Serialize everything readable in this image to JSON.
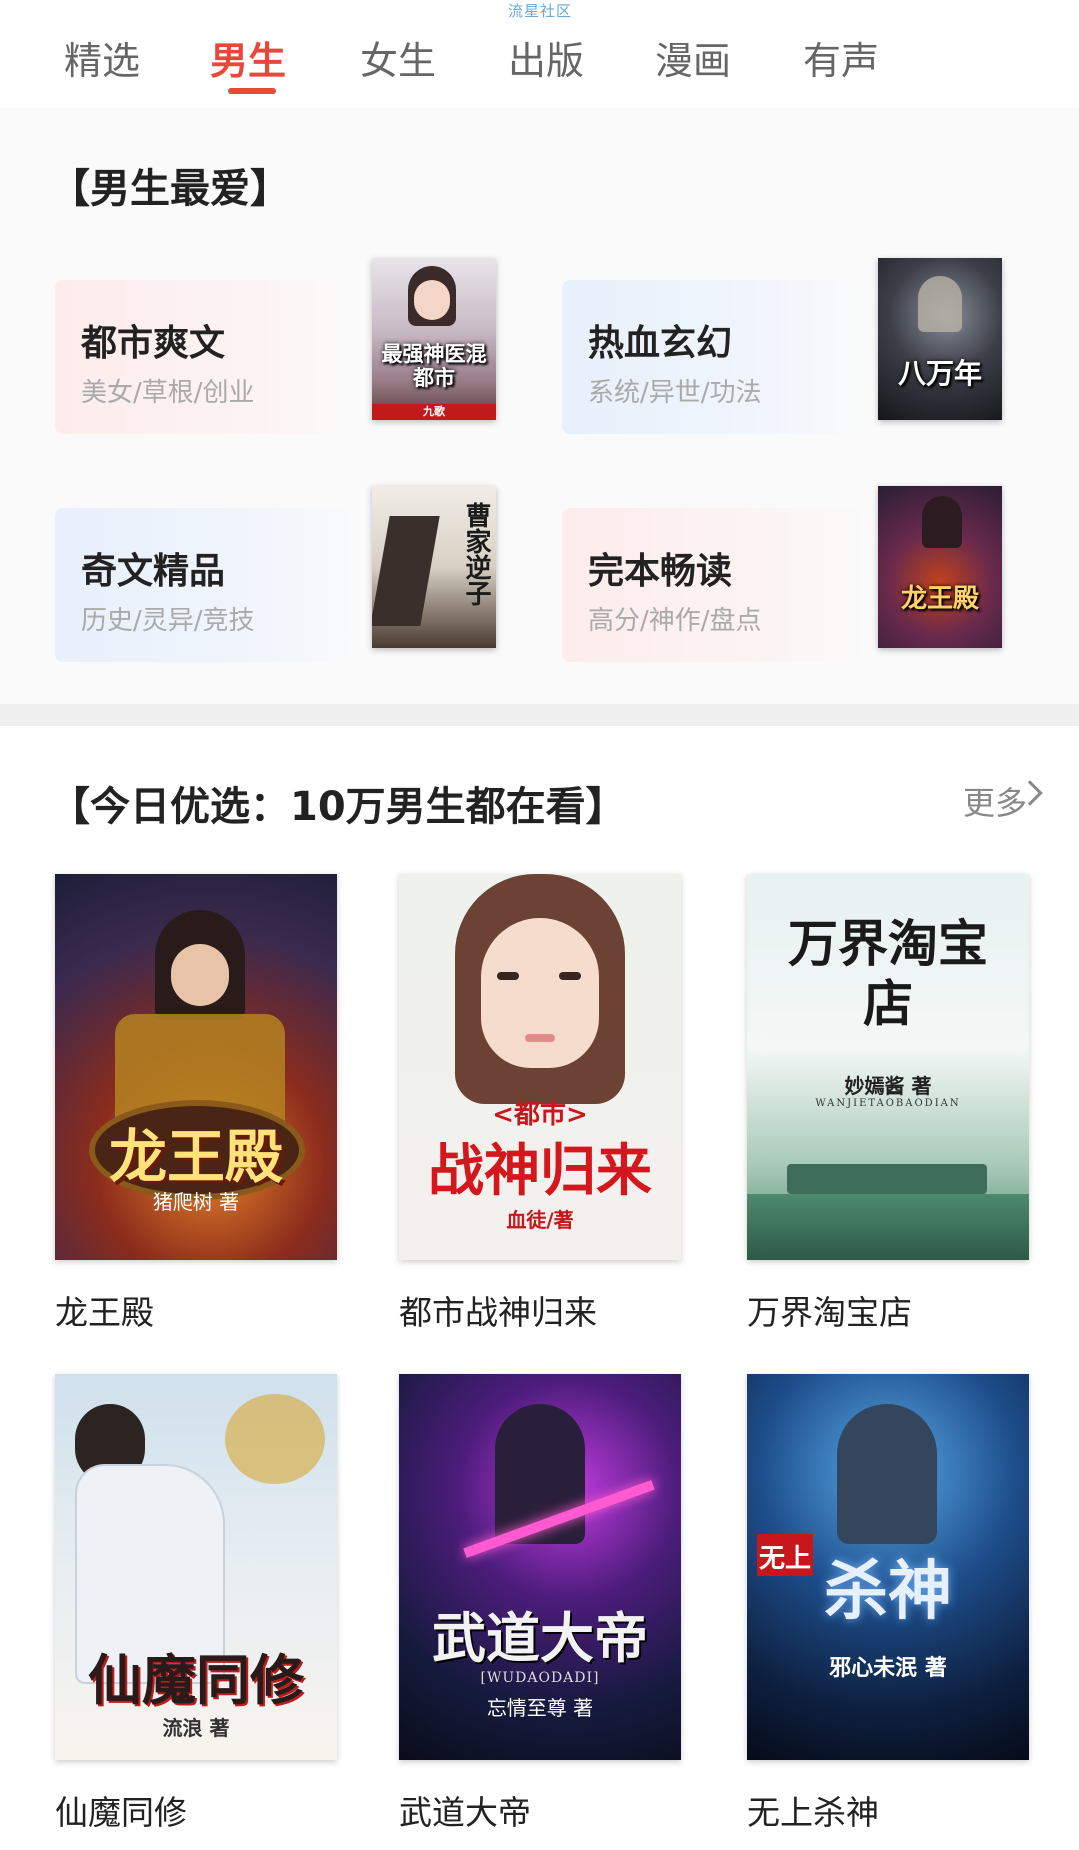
{
  "watermark": "流星社区",
  "tabs": [
    "精选",
    "男生",
    "女生",
    "出版",
    "漫画",
    "有声"
  ],
  "active_tab": "男生",
  "favorites": {
    "title": "【男生最爱】",
    "categories": [
      {
        "name": "都市爽文",
        "sub": "美女/草根/创业",
        "cover_title": "最强神医混都市",
        "cover_author": "九歌"
      },
      {
        "name": "热血玄幻",
        "sub": "系统/异世/功法",
        "cover_title": "八万年"
      },
      {
        "name": "奇文精品",
        "sub": "历史/灵异/竞技",
        "cover_title": "曹家逆子"
      },
      {
        "name": "完本畅读",
        "sub": "高分/神作/盘点",
        "cover_title": "龙王殿"
      }
    ]
  },
  "today": {
    "title": "【今日优选：10万男生都在看】",
    "more": "更多",
    "books": [
      {
        "title": "龙王殿",
        "cover_title": "龙王殿",
        "cover_author": "猪爬树 著"
      },
      {
        "title": "都市战神归来",
        "cover_title": "战神归来",
        "cover_tag": "<都市>",
        "cover_author": "血徒/著"
      },
      {
        "title": "万界淘宝店",
        "cover_title": "万界淘宝店",
        "cover_author": "妙嫣酱 著",
        "cover_pinyin": "WANJIETAOBAODIAN"
      },
      {
        "title": "仙魔同修",
        "cover_title": "仙魔同修",
        "cover_author": "流浪 著"
      },
      {
        "title": "武道大帝",
        "cover_title": "武道大帝",
        "cover_pinyin": "[WUDAODADI]",
        "cover_author": "忘情至尊 著"
      },
      {
        "title": "无上杀神",
        "cover_title": "杀神",
        "cover_tag": "无上",
        "cover_author": "邪心未泯 著"
      }
    ]
  }
}
